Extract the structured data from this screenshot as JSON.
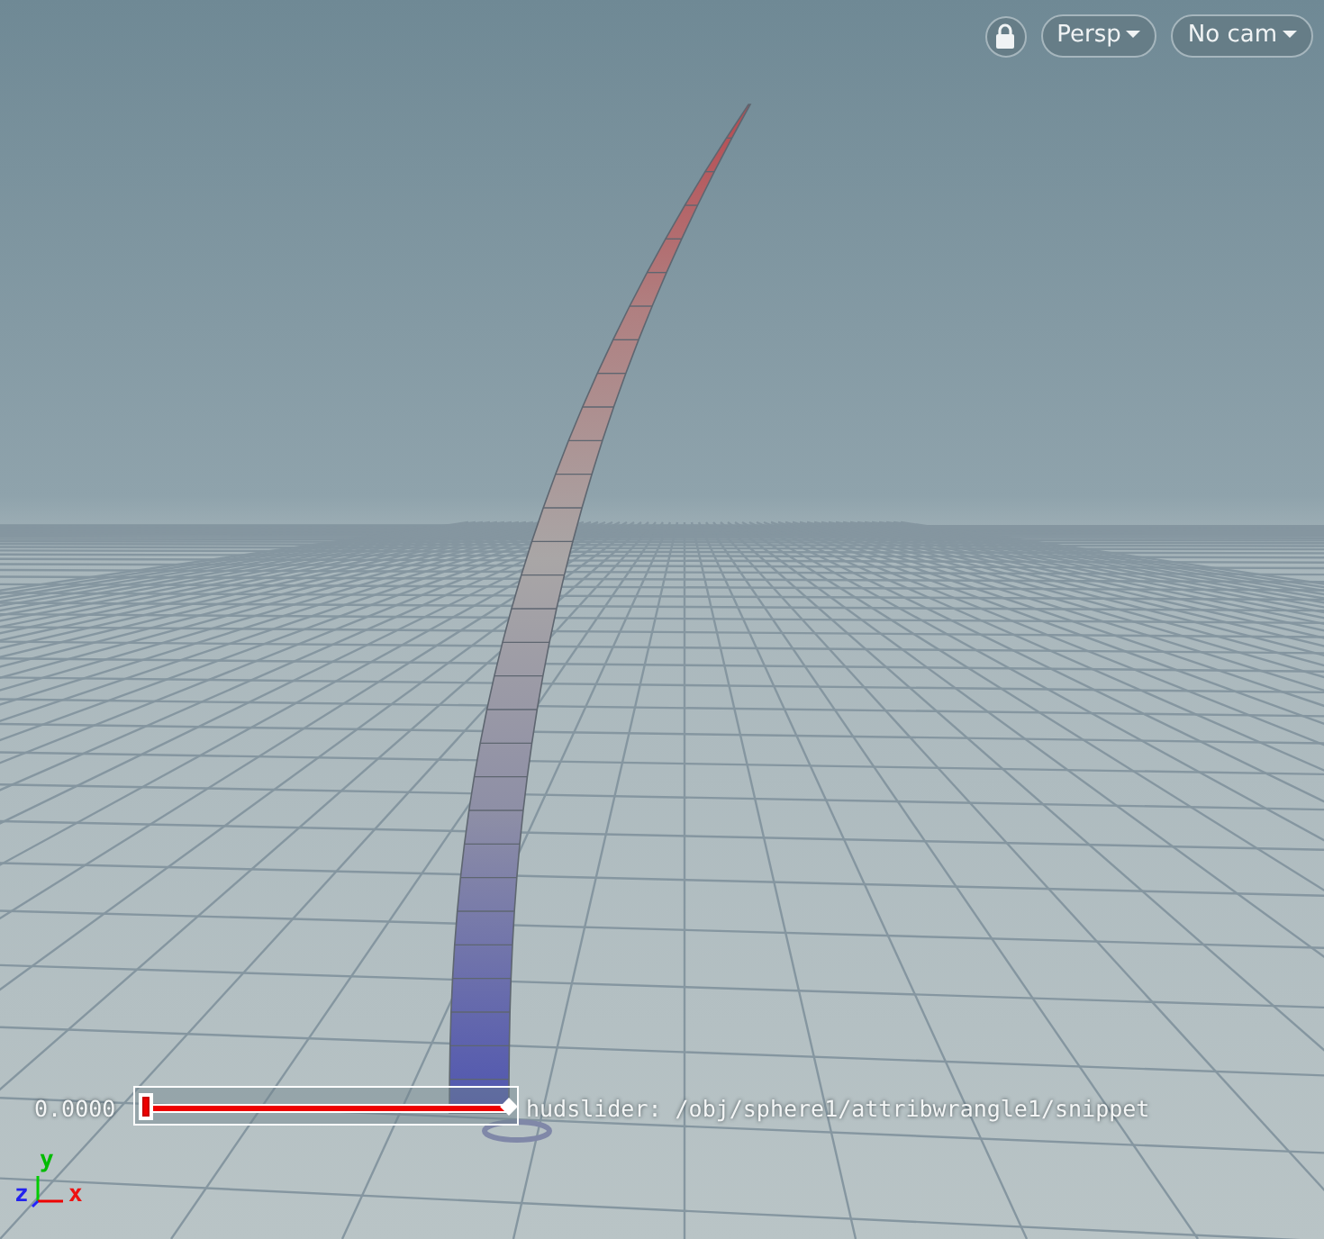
{
  "toolbar": {
    "lock_button": {
      "locked": true
    },
    "view_menu": "Persp",
    "camera_menu": "No cam"
  },
  "hud_slider": {
    "value": "0.0000",
    "level": 0,
    "label": "hudslider: /obj/sphere1/attribwrangle1/snippet"
  },
  "axes": {
    "y": "y",
    "z": "z",
    "x": "x"
  }
}
